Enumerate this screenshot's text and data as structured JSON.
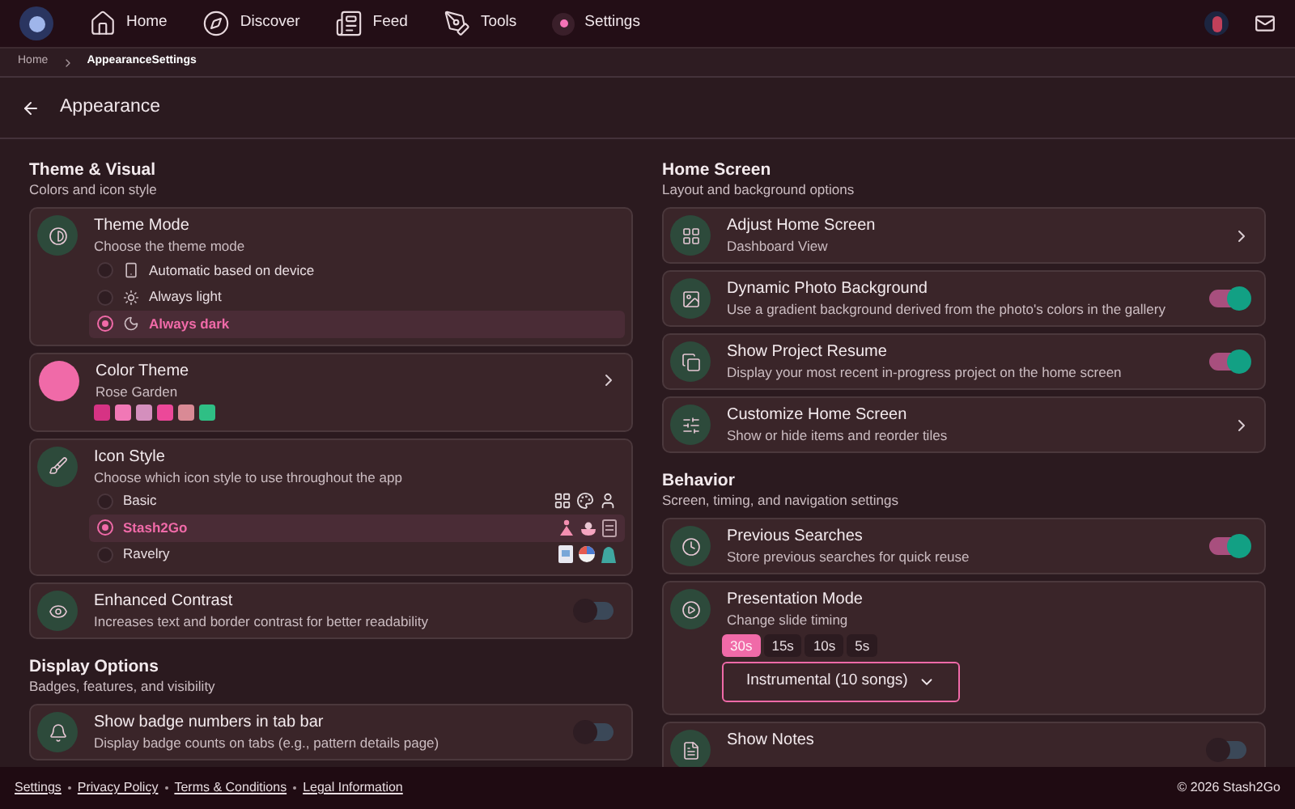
{
  "nav": {
    "items": [
      {
        "label": "Home"
      },
      {
        "label": "Discover"
      },
      {
        "label": "Feed"
      },
      {
        "label": "Tools"
      },
      {
        "label": "Settings"
      }
    ]
  },
  "breadcrumb": [
    {
      "label": "Home",
      "current": false
    },
    {
      "label": "AppearanceSettings",
      "current": true
    }
  ],
  "page_title": "Appearance",
  "columns": [
    [
      {
        "title": "Theme & Visual",
        "subtitle": "Colors and icon style",
        "cards": [
          {
            "kind": "mode",
            "title": "Theme Mode",
            "subtitle": "Choose the theme mode",
            "options": [
              {
                "label": "Automatic based on device",
                "selected": false
              },
              {
                "label": "Always light",
                "selected": false
              },
              {
                "label": "Always dark",
                "selected": true
              }
            ]
          },
          {
            "kind": "colors",
            "title": "Color Theme",
            "subtitle": "Rose Garden",
            "colors": [
              {
                "color": "#d63384"
              },
              {
                "color": "#f178b6"
              },
              {
                "color": "#d48fbd"
              },
              {
                "color": "#ec4899"
              },
              {
                "color": "#d98a95"
              },
              {
                "color": "#2fbf85"
              }
            ]
          },
          {
            "kind": "icon_style",
            "title": "Icon Style",
            "subtitle": "Choose which icon style to use throughout the app",
            "options": [
              {
                "label": "Basic",
                "selected": false
              },
              {
                "label": "Stash2Go",
                "selected": true
              },
              {
                "label": "Ravelry",
                "selected": false
              }
            ]
          },
          {
            "kind": "toggle",
            "title": "Enhanced Contrast",
            "subtitle": "Increases text and border contrast for better readability",
            "on": false
          }
        ]
      },
      {
        "title": "Display Options",
        "subtitle": "Badges, features, and visibility",
        "cards": [
          {
            "kind": "toggle",
            "title": "Show badge numbers in tab bar",
            "subtitle": "Display badge counts on tabs (e.g., pattern details page)",
            "on": false
          }
        ]
      }
    ],
    [
      {
        "title": "Home Screen",
        "subtitle": "Layout and background options",
        "cards": [
          {
            "kind": "link",
            "title": "Adjust Home Screen",
            "subtitle": "Dashboard View"
          },
          {
            "kind": "toggle",
            "title": "Dynamic Photo Background",
            "subtitle": "Use a gradient background derived from the photo's colors in the gallery",
            "on": true
          },
          {
            "kind": "toggle",
            "title": "Show Project Resume",
            "subtitle": "Display your most recent in-progress project on the home screen",
            "on": true
          },
          {
            "kind": "link",
            "title": "Customize Home Screen",
            "subtitle": "Show or hide items and reorder tiles"
          }
        ]
      },
      {
        "title": "Behavior",
        "subtitle": "Screen, timing, and navigation settings",
        "cards": [
          {
            "kind": "toggle",
            "title": "Previous Searches",
            "subtitle": "Store previous searches for quick reuse",
            "on": true
          },
          {
            "kind": "segmented",
            "title": "Presentation Mode",
            "subtitle": "Change slide timing",
            "options": [
              {
                "label": "30s",
                "selected": true
              },
              {
                "label": "15s",
                "selected": false
              },
              {
                "label": "10s",
                "selected": false
              },
              {
                "label": "5s",
                "selected": false
              }
            ],
            "select": "Instrumental (10 songs)"
          },
          {
            "kind": "toggle",
            "title": "Show Notes",
            "on": false
          }
        ]
      }
    ]
  ],
  "footer": {
    "links": [
      "Settings",
      "Privacy Policy",
      "Terms & Conditions",
      "Legal Information"
    ],
    "copyright": "© 2026 Stash2Go"
  }
}
